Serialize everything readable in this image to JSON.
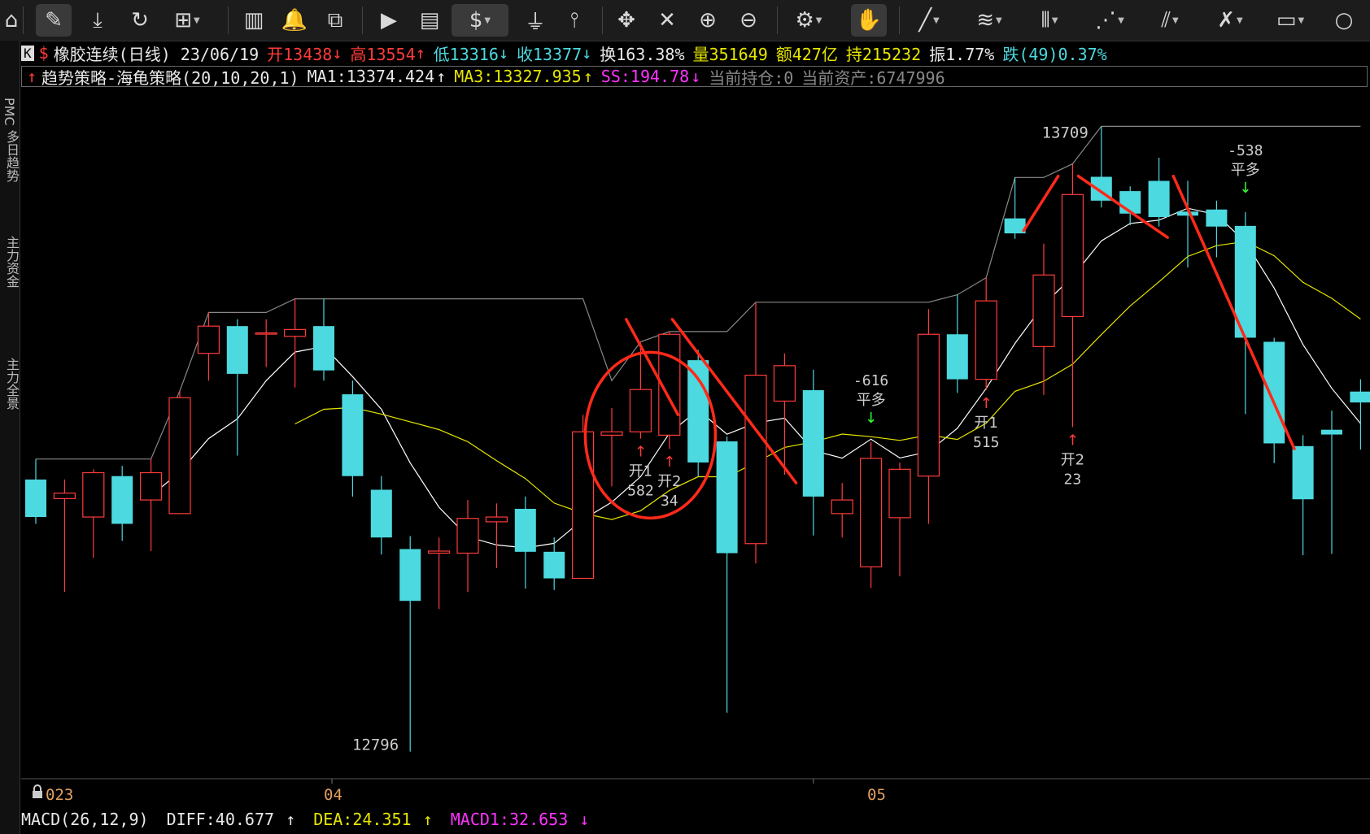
{
  "toolbar": {
    "icons": [
      "home-icon",
      "ruler-icon",
      "download-icon",
      "refresh-icon",
      "grid-icon",
      "candle-chart-icon",
      "alert-bell-icon",
      "line-chart-icon",
      "play-icon",
      "document-icon",
      "dollar-icon",
      "filter-icon",
      "indicator-icon",
      "move-icon",
      "eraser-icon",
      "zoom-in-icon",
      "zoom-out-icon",
      "settings-icon",
      "mouse-icon",
      "draw-line-icon",
      "fibonacci-icon",
      "vertical-lines-icon",
      "fan-icon",
      "parallel-lines-icon",
      "cross-lines-icon",
      "rectangle-icon",
      "circle-icon"
    ],
    "dollar": "$"
  },
  "left_rail": [
    "PMC",
    "多日趋势",
    "主力资金",
    "主力全景"
  ],
  "header": {
    "badge": "K",
    "symbol_mark": "$",
    "name_period": "橡胶连续(日线) 23/06/19",
    "open": "开13438",
    "open_arrow": "↓",
    "high": "高13554",
    "high_arrow": "↑",
    "low": "低13316",
    "low_arrow": "↓",
    "close": "收13377",
    "close_arrow": "↓",
    "turnover": "换163.38%",
    "volume": "量351649",
    "amount": "额427亿",
    "open_interest": "持215232",
    "amplitude": "振1.77%",
    "change": "跌(49)0.37%"
  },
  "strategy": {
    "arrow": "↑",
    "name": "趋势策略-海龟策略(20,10,20,1)",
    "ma1": "MA1:13374.424",
    "ma1_arrow": "↑",
    "ma3": "MA3:13327.935",
    "ma3_arrow": "↑",
    "ss": "SS:194.78",
    "ss_arrow": "↓",
    "position": "当前持仓:0",
    "assets": "当前资产:6747996"
  },
  "macd": {
    "name": "MACD(26,12,9)",
    "diff": "DIFF:40.677",
    "diff_arrow": "↑",
    "dea": "DEA:24.351",
    "dea_arrow": "↑",
    "macd1": "MACD1:32.653",
    "macd1_arrow": "↓"
  },
  "x_axis": {
    "labels": [
      "023",
      "04",
      "05"
    ]
  },
  "colors": {
    "up": "#ff3b3b",
    "down": "#4dd9e0",
    "ma1": "#ffffff",
    "ma3": "#e6e600",
    "ss": "#888888",
    "annot": "#ff2a1a"
  },
  "chart_data": {
    "type": "candlestick",
    "price_range": [
      12780,
      13760
    ],
    "high_label": "13709",
    "low_label": "12796",
    "candles": [
      {
        "o": 13195,
        "c": 13140,
        "h": 13225,
        "l": 13130
      },
      {
        "o": 13167,
        "c": 13175,
        "h": 13195,
        "l": 13030
      },
      {
        "o": 13140,
        "c": 13205,
        "h": 13210,
        "l": 13080
      },
      {
        "o": 13200,
        "c": 13130,
        "h": 13215,
        "l": 13105
      },
      {
        "o": 13165,
        "c": 13205,
        "h": 13225,
        "l": 13090
      },
      {
        "o": 13145,
        "c": 13315,
        "h": 13325,
        "l": 13145
      },
      {
        "o": 13380,
        "c": 13420,
        "h": 13440,
        "l": 13340
      },
      {
        "o": 13420,
        "c": 13350,
        "h": 13430,
        "l": 13230
      },
      {
        "o": 13410,
        "c": 13410,
        "h": 13430,
        "l": 13360
      },
      {
        "o": 13405,
        "c": 13415,
        "h": 13460,
        "l": 13330
      },
      {
        "o": 13420,
        "c": 13355,
        "h": 13460,
        "l": 13340
      },
      {
        "o": 13320,
        "c": 13200,
        "h": 13340,
        "l": 13170
      },
      {
        "o": 13180,
        "c": 13110,
        "h": 13200,
        "l": 13085
      },
      {
        "o": 13093,
        "c": 13017,
        "h": 13112,
        "l": 12796
      },
      {
        "o": 13087,
        "c": 13090,
        "h": 13110,
        "l": 13005
      },
      {
        "o": 13087,
        "c": 13138,
        "h": 13165,
        "l": 13030
      },
      {
        "o": 13133,
        "c": 13140,
        "h": 13160,
        "l": 13065
      },
      {
        "o": 13152,
        "c": 13089,
        "h": 13170,
        "l": 13035
      },
      {
        "o": 13089,
        "c": 13050,
        "h": 13110,
        "l": 13033
      },
      {
        "o": 13050,
        "c": 13265,
        "h": 13290,
        "l": 13050
      },
      {
        "o": 13260,
        "c": 13265,
        "h": 13300,
        "l": 13185
      },
      {
        "o": 13265,
        "c": 13327,
        "h": 13397,
        "l": 13255
      },
      {
        "o": 13260,
        "c": 13408,
        "h": 13412,
        "l": 13240
      },
      {
        "o": 13370,
        "c": 13220,
        "h": 13385,
        "l": 13200
      },
      {
        "o": 13251,
        "c": 13087,
        "h": 13258,
        "l": 12853
      },
      {
        "o": 13101,
        "c": 13348,
        "h": 13455,
        "l": 13072
      },
      {
        "o": 13310,
        "c": 13362,
        "h": 13380,
        "l": 13202
      },
      {
        "o": 13326,
        "c": 13170,
        "h": 13356,
        "l": 13113
      },
      {
        "o": 13145,
        "c": 13165,
        "h": 13190,
        "l": 13110
      },
      {
        "o": 13067,
        "c": 13226,
        "h": 13250,
        "l": 13036
      },
      {
        "o": 13139,
        "c": 13210,
        "h": 13220,
        "l": 13053
      },
      {
        "o": 13200,
        "c": 13408,
        "h": 13445,
        "l": 13130
      },
      {
        "o": 13408,
        "c": 13342,
        "h": 13466,
        "l": 13322
      },
      {
        "o": 13342,
        "c": 13457,
        "h": 13491,
        "l": 13326
      },
      {
        "o": 13578,
        "c": 13556,
        "h": 13638,
        "l": 13548
      },
      {
        "o": 13390,
        "c": 13495,
        "h": 13541,
        "l": 13319
      },
      {
        "o": 13434,
        "c": 13613,
        "h": 13658,
        "l": 13272
      },
      {
        "o": 13639,
        "c": 13604,
        "h": 13713,
        "l": 13594
      },
      {
        "o": 13618,
        "c": 13585,
        "h": 13625,
        "l": 13568
      },
      {
        "o": 13633,
        "c": 13580,
        "h": 13667,
        "l": 13566
      },
      {
        "o": 13588,
        "c": 13582,
        "h": 13633,
        "l": 13506
      },
      {
        "o": 13591,
        "c": 13566,
        "h": 13604,
        "l": 13521
      },
      {
        "o": 13567,
        "c": 13403,
        "h": 13587,
        "l": 13291
      },
      {
        "o": 13397,
        "c": 13248,
        "h": 13403,
        "l": 13219
      },
      {
        "o": 13244,
        "c": 13166,
        "h": 13260,
        "l": 13084
      },
      {
        "o": 13268,
        "c": 13261,
        "h": 13296,
        "l": 13086
      },
      {
        "o": 13324,
        "c": 13308,
        "h": 13342,
        "l": 13239
      }
    ],
    "annotations": [
      {
        "kind": "open-long",
        "label": "开1",
        "value": "582",
        "i": 21
      },
      {
        "kind": "open-long",
        "label": "开2",
        "value": "34",
        "i": 22
      },
      {
        "kind": "close-long",
        "label": "平多",
        "value": "-616",
        "i": 29
      },
      {
        "kind": "open-long",
        "label": "开1",
        "value": "515",
        "i": 33
      },
      {
        "kind": "open-long",
        "label": "开2",
        "value": "23",
        "i": 36
      },
      {
        "kind": "close-long",
        "label": "平多",
        "value": "-538",
        "i": 42
      }
    ]
  }
}
